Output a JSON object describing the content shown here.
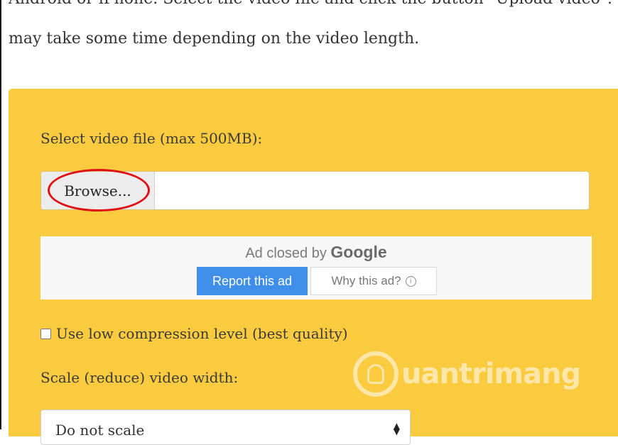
{
  "intro": {
    "clipped_line": "Android or iPhone. Select the video file and click the button \"Upload video\". It",
    "line": "may take some time depending on the video length."
  },
  "form": {
    "file_label": "Select video file (max 500MB):",
    "browse_label": "Browse...",
    "low_compression_label": "Use low compression level (best quality)",
    "low_compression_checked": false,
    "scale_label": "Scale (reduce) video width:",
    "scale_select_value": "Do not scale"
  },
  "ad": {
    "closed_text": "Ad closed by",
    "brand": "Google",
    "report_label": "Report this ad",
    "why_label": "Why this ad?",
    "why_icon": "info-icon"
  },
  "watermark": {
    "text": "uantrimang"
  },
  "colors": {
    "panel": "#fbcb3f",
    "report_button": "#3f8eea",
    "highlight": "#e10f14"
  }
}
